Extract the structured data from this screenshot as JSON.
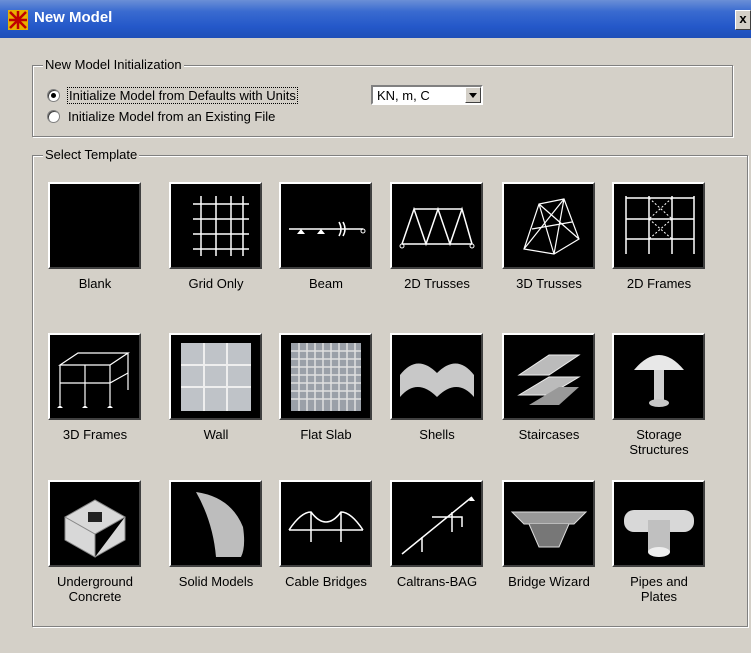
{
  "window": {
    "title": "New Model",
    "close_label": "x"
  },
  "init_group": {
    "legend": "New Model Initialization",
    "option_defaults": "Initialize Model from Defaults with Units",
    "option_existing": "Initialize Model  from an Existing File",
    "selected_option": "defaults",
    "units_value": "KN, m, C"
  },
  "template_group": {
    "legend": "Select Template",
    "templates": [
      {
        "label": "Blank",
        "icon": "blank-icon"
      },
      {
        "label": "Grid Only",
        "icon": "grid-icon"
      },
      {
        "label": "Beam",
        "icon": "beam-icon"
      },
      {
        "label": "2D Trusses",
        "icon": "truss-2d-icon"
      },
      {
        "label": "3D Trusses",
        "icon": "truss-3d-icon"
      },
      {
        "label": "2D Frames",
        "icon": "frame-2d-icon"
      },
      {
        "label": "3D Frames",
        "icon": "frame-3d-icon"
      },
      {
        "label": "Wall",
        "icon": "wall-icon"
      },
      {
        "label": "Flat Slab",
        "icon": "flat-slab-icon"
      },
      {
        "label": "Shells",
        "icon": "shells-icon"
      },
      {
        "label": "Staircases",
        "icon": "staircase-icon"
      },
      {
        "label": "Storage\nStructures",
        "icon": "storage-icon"
      },
      {
        "label": "Underground\nConcrete",
        "icon": "underground-icon"
      },
      {
        "label": "Solid Models",
        "icon": "solid-icon"
      },
      {
        "label": "Cable Bridges",
        "icon": "cable-bridge-icon"
      },
      {
        "label": "Caltrans-BAG",
        "icon": "caltrans-icon"
      },
      {
        "label": "Bridge Wizard",
        "icon": "bridge-wizard-icon"
      },
      {
        "label": "Pipes and\nPlates",
        "icon": "pipes-icon"
      }
    ]
  }
}
